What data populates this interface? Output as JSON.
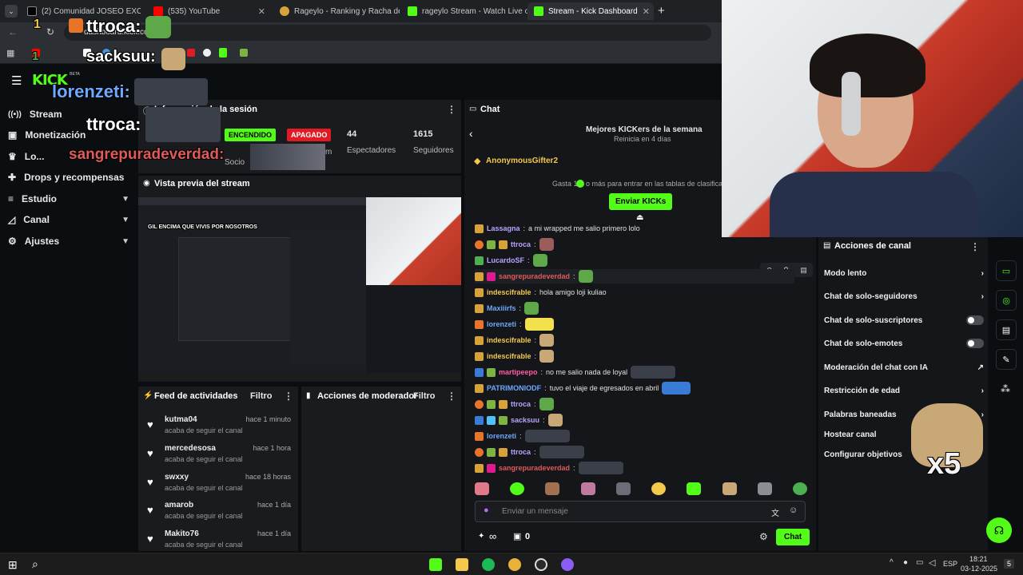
{
  "browser": {
    "tabs": [
      {
        "title": "(2) Comunidad JOSEO EXCLUSIV",
        "color": "#cccccc"
      },
      {
        "title": "(535) YouTube",
        "color": "#ff0000"
      },
      {
        "title": "Rageylo - Ranking y Racha de s",
        "color": "#d8a23a"
      },
      {
        "title": "rageylo Stream - Watch Live on",
        "color": "#53fc18"
      },
      {
        "title": "Stream - Kick Dashboard",
        "color": "#53fc18"
      }
    ],
    "url": "dashboard.kick.com"
  },
  "overlay": {
    "user1": "ttroca:",
    "user2": "sacksuu:",
    "user3": "lorenzeti:",
    "user4": "ttroca:",
    "user5": "sangrepuradeverdad:",
    "count1": "1",
    "count2": "1",
    "multiplier": "x5"
  },
  "logo": {
    "text": "KICK",
    "beta": "BETA"
  },
  "sidebar": {
    "items": [
      {
        "label": "Stream",
        "icon": "broadcast-icon"
      },
      {
        "label": "Monetización",
        "icon": "wallet-icon"
      },
      {
        "label": "Lo...",
        "icon": "trophy-icon"
      },
      {
        "label": "Drops y recompensas",
        "icon": "gift-icon"
      },
      {
        "label": "Estudio",
        "icon": "sliders-icon"
      },
      {
        "label": "Canal",
        "icon": "chart-icon"
      },
      {
        "label": "Ajustes",
        "icon": "gear-icon"
      }
    ]
  },
  "session": {
    "title": "Información de la sesión",
    "on_label": "ENCENDIDO",
    "off_label": "APAGADO",
    "viewers": "44",
    "viewers_label": "Espectadores",
    "followers": "1615",
    "followers_label": "Seguidores",
    "partner_label": "Socio",
    "duration_label": "m"
  },
  "preview": {
    "title": "Vista previa del stream",
    "overlay_text": "GIL ENCIMA QUE VIVIS POR NOSOTROS"
  },
  "activity": {
    "title": "Feed de actividades",
    "filter": "Filtro",
    "items": [
      {
        "name": "kutma04",
        "time": "hace 1 minuto",
        "sub": "acaba de seguir el canal"
      },
      {
        "name": "mercedesosa",
        "time": "hace 1 hora",
        "sub": "acaba de seguir el canal"
      },
      {
        "name": "swxxy",
        "time": "hace 18 horas",
        "sub": "acaba de seguir el canal"
      },
      {
        "name": "amarob",
        "time": "hace 1 día",
        "sub": "acaba de seguir el canal"
      },
      {
        "name": "Makito76",
        "time": "hace 1 día",
        "sub": "acaba de seguir el canal"
      }
    ]
  },
  "moderator": {
    "title": "Acciones de moderador",
    "filter": "Filtro"
  },
  "chat": {
    "title": "Chat",
    "leaderboard_title": "Mejores KICKers de la semana",
    "leaderboard_sub": "Reinicia en 4 días",
    "gifter": "AnonymousGifter2",
    "spend_text": "Gasta 1",
    "spend_text2": "o más para entrar en las tablas de clasificación",
    "send_kicks": "Enviar KICKs",
    "messages": [
      {
        "name": "Lassagna",
        "color": "#b9a3ff",
        "text": "a mi wrapped me salio primero lolo",
        "badge": "#d8a23a"
      },
      {
        "name": "ttroca",
        "color": "#b9a3ff",
        "text": "",
        "badge": "#d8a23a"
      },
      {
        "name": "LucardoSF",
        "color": "#b9a3ff",
        "text": "",
        "badge": "#4caf50"
      },
      {
        "name": "sangrepuradeverdad",
        "color": "#e05a5a",
        "text": "",
        "badge": "#d8a23a"
      },
      {
        "name": "indescifrable",
        "color": "#f2c94c",
        "text": "hola amigo loji kuliao",
        "badge": "#d8a23a"
      },
      {
        "name": "Maxiiirfs",
        "color": "#6fa8ff",
        "text": "",
        "badge": "#d8a23a"
      },
      {
        "name": "lorenzeti",
        "color": "#6fa8ff",
        "text": "",
        "badge": "#e8742a"
      },
      {
        "name": "indescifrable",
        "color": "#f2c94c",
        "text": "",
        "badge": "#d8a23a"
      },
      {
        "name": "indescifrable",
        "color": "#f2c94c",
        "text": "",
        "badge": "#d8a23a"
      },
      {
        "name": "martipeepo",
        "color": "#ff5ca8",
        "text": "no me salio nada de loyal",
        "badge": "#3a7bd5"
      },
      {
        "name": "PATRIMONIODF",
        "color": "#6fa8ff",
        "text": "tuvo el viaje de egresados en abril",
        "badge": "#d8a23a"
      },
      {
        "name": "ttroca",
        "color": "#b9a3ff",
        "text": "",
        "badge": "#d8a23a"
      },
      {
        "name": "sacksuu",
        "color": "#b9a3ff",
        "text": "",
        "badge": "#3a7bd5"
      },
      {
        "name": "lorenzeti",
        "color": "#6fa8ff",
        "text": "",
        "badge": "#e8742a"
      },
      {
        "name": "ttroca",
        "color": "#b9a3ff",
        "text": "",
        "badge": "#d8a23a"
      },
      {
        "name": "sangrepuradeverdad",
        "color": "#e05a5a",
        "text": "",
        "badge": "#d8a23a"
      }
    ],
    "input_placeholder": "Enviar un mensaje",
    "infinity": "∞",
    "box_count": "0",
    "chat_button": "Chat"
  },
  "channel_actions": {
    "title": "Acciones de canal",
    "items": [
      {
        "label": "Modo lento",
        "control": "chevron"
      },
      {
        "label": "Chat de solo-seguidores",
        "control": "chevron"
      },
      {
        "label": "Chat de solo-suscriptores",
        "control": "toggle"
      },
      {
        "label": "Chat de solo-emotes",
        "control": "toggle"
      },
      {
        "label": "Moderación del chat con IA",
        "control": "external"
      },
      {
        "label": "Restricción de edad",
        "control": "chevron"
      },
      {
        "label": "Palabras baneadas",
        "control": "chevron"
      },
      {
        "label": "Hostear canal",
        "control": "none"
      },
      {
        "label": "Configurar objetivos",
        "control": "none"
      }
    ]
  },
  "taskbar": {
    "lang": "ESP",
    "time": "18:21",
    "date": "03-12-2025",
    "notif": "5"
  },
  "colors": {
    "accent": "#53fc18",
    "bg": "#0b0e11",
    "panel": "#191b1f",
    "danger": "#e01b24"
  }
}
